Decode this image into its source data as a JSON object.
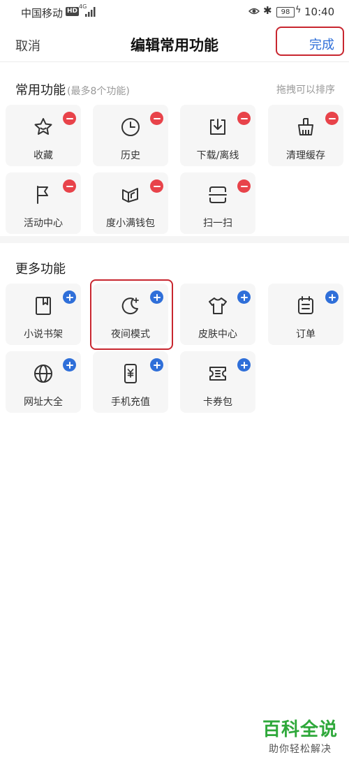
{
  "status_bar": {
    "carrier": "中国移动",
    "hd": "HD",
    "network": "4G",
    "battery": "98",
    "time": "10:40"
  },
  "header": {
    "cancel_label": "取消",
    "title": "编辑常用功能",
    "done_label": "完成"
  },
  "common": {
    "title": "常用功能",
    "hint": "(最多8个功能)",
    "right_hint": "拖拽可以排序",
    "items": [
      {
        "label": "收藏",
        "icon": "star-icon"
      },
      {
        "label": "历史",
        "icon": "clock-icon"
      },
      {
        "label": "下载/离线",
        "icon": "download-icon"
      },
      {
        "label": "清理缓存",
        "icon": "broom-icon"
      },
      {
        "label": "活动中心",
        "icon": "flag-icon"
      },
      {
        "label": "度小满钱包",
        "icon": "wallet-icon"
      },
      {
        "label": "扫一扫",
        "icon": "scan-icon"
      }
    ]
  },
  "more": {
    "title": "更多功能",
    "items": [
      {
        "label": "小说书架",
        "icon": "book-icon"
      },
      {
        "label": "夜间模式",
        "icon": "moon-icon"
      },
      {
        "label": "皮肤中心",
        "icon": "shirt-icon"
      },
      {
        "label": "订单",
        "icon": "order-icon"
      },
      {
        "label": "网址大全",
        "icon": "globe-icon"
      },
      {
        "label": "手机充值",
        "icon": "phone-recharge-icon"
      },
      {
        "label": "卡券包",
        "icon": "coupon-icon"
      }
    ]
  },
  "watermark": {
    "title": "百科全说",
    "subtitle": "助你轻松解决"
  },
  "colors": {
    "accent_blue": "#2f6fd9",
    "remove_red": "#e8434a",
    "highlight_red": "#c8262f",
    "watermark_green": "#2ea83a"
  }
}
